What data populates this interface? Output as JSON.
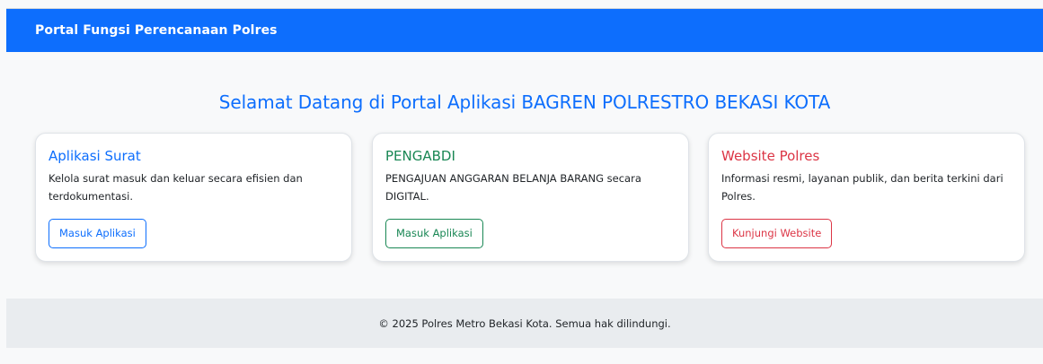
{
  "navbar": {
    "brand": "Portal Fungsi Perencanaan Polres"
  },
  "main": {
    "headline": "Selamat Datang di Portal Aplikasi BAGREN POLRESTRO BEKASI KOTA",
    "cards": [
      {
        "title": "Aplikasi Surat",
        "text": "Kelola surat masuk dan keluar secara efisien dan terdokumentasi.",
        "button": "Masuk Aplikasi",
        "accent": "#0d6efd"
      },
      {
        "title": "PENGABDI",
        "text": "PENGAJUAN ANGGARAN BELANJA BARANG secara DIGITAL.",
        "button": "Masuk Aplikasi",
        "accent": "#198754"
      },
      {
        "title": "Website Polres",
        "text": "Informasi resmi, layanan publik, dan berita terkini dari Polres.",
        "button": "Kunjungi Website",
        "accent": "#dc3545"
      }
    ]
  },
  "footer": {
    "text": "© 2025 Polres Metro Bekasi Kota. Semua hak dilindungi."
  },
  "colors": {
    "navbar_bg": "#0d6efd",
    "page_bg": "#f8f9fa",
    "footer_bg": "#e9ecef"
  }
}
